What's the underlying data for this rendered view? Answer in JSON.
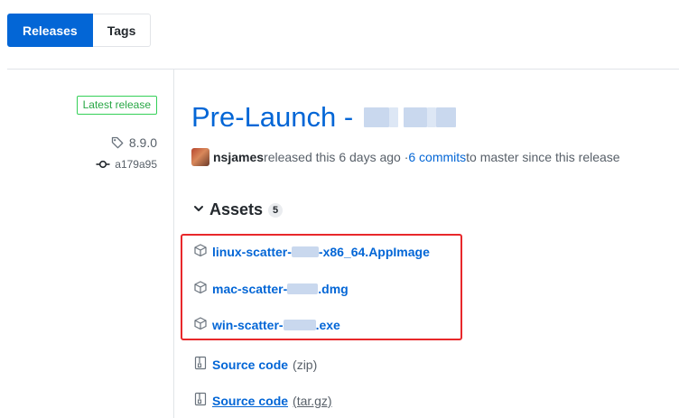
{
  "tabs": {
    "releases_label": "Releases",
    "tags_label": "Tags"
  },
  "sidebar": {
    "latest_badge": "Latest release",
    "tag": "8.9.0",
    "commit": "a179a95"
  },
  "release": {
    "title": "Pre-Launch -",
    "author": "nsjames",
    "released_text": " released this 6 days ago · ",
    "commits_link": "6 commits",
    "branch_text": " to master since this release"
  },
  "assets": {
    "heading": "Assets",
    "count": "5",
    "files": [
      {
        "prefix": "linux-scatter-",
        "suffix": "-x86_64.AppImage"
      },
      {
        "prefix": "mac-scatter-",
        "suffix": ".dmg"
      },
      {
        "prefix": "win-scatter-",
        "suffix": ".exe"
      }
    ],
    "source_zip": {
      "label": "Source code",
      "format": "(zip)"
    },
    "source_tar": {
      "label": "Source code",
      "format": "(tar.gz)"
    }
  },
  "colors": {
    "accent": "#0366d6",
    "highlight": "#e8282b",
    "latest_green": "#28a745"
  }
}
